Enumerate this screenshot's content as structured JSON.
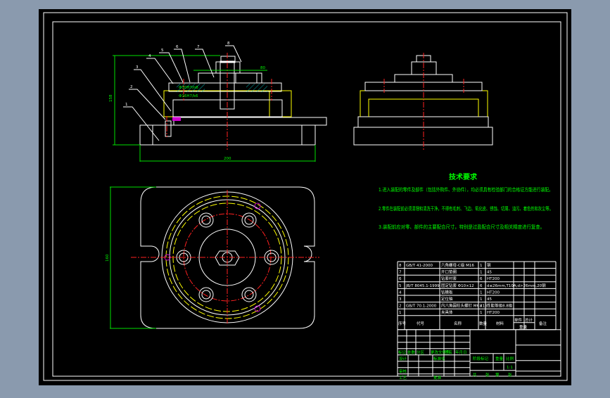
{
  "colors": {
    "background": "#8a9aae",
    "canvas": "#000000",
    "outline": "#ffffff",
    "hidden": "#ffff00",
    "center": "#ff2020",
    "dimension": "#00e000",
    "hatch": "#00d8d8"
  },
  "front_view": {
    "leaders": [
      "1",
      "2",
      "3",
      "4",
      "5",
      "6",
      "7",
      "8"
    ],
    "dims": {
      "height": "158",
      "width": "200",
      "fit1": "Φ10H7/n6",
      "fit2": "Φ16H7/k6",
      "pitch": "80"
    }
  },
  "top_view": {
    "dims": {
      "height": "160"
    }
  },
  "tech_requirements": {
    "title": "技术要求",
    "items": [
      "1.进入装配的零件及部件（包括外购件、外协件），均必须具有检验部门的合格证方能进行装配。",
      "2.零件在装配前必须清理和清洗干净，不得有毛刺、飞边、氧化皮、锈蚀、切屑、油污、着色剂和灰尘等。",
      "3.装配前应对零、部件的主要配合尺寸，特别是过盈配合尺寸及相关精度进行复查。"
    ]
  },
  "parts_list": {
    "rows": [
      {
        "no": "8",
        "code": "GB/T 41-2000",
        "name": "六角螺母-C级 M16",
        "qty": "1",
        "material": "钢"
      },
      {
        "no": "7",
        "code": "",
        "name": "开口垫圈",
        "qty": "1",
        "material": "45"
      },
      {
        "no": "6",
        "code": "",
        "name": "钻套衬套",
        "qty": "6",
        "material": "HT200"
      },
      {
        "no": "5",
        "code": "JB/T 8045.1-1999",
        "name": "固定钻套 Φ10×12",
        "qty": "6",
        "material": "d≤26mm,T10A;d>26mm,20钢"
      },
      {
        "no": "4",
        "code": "",
        "name": "钻模板",
        "qty": "1",
        "material": "HT200"
      },
      {
        "no": "3",
        "code": "",
        "name": "定位轴",
        "qty": "1",
        "material": "45"
      },
      {
        "no": "2",
        "code": "GB/T 70.1-2000",
        "name": "内六角圆柱头螺钉 M6×16",
        "qty": "3",
        "material": "性能等级8.8级"
      },
      {
        "no": "1",
        "code": "",
        "name": "夹具体",
        "qty": "1",
        "material": "HT200"
      }
    ],
    "header": {
      "no": "序号",
      "code": "代号",
      "name": "名称",
      "qty": "数量",
      "material": "材料",
      "single": "单件",
      "total": "总计",
      "weight": "重量",
      "remark": "备注"
    }
  },
  "title_block": {
    "revision_labels": [
      "标记",
      "处数",
      "分区",
      "更改文件号",
      "签名",
      "年月日"
    ],
    "design": "设计",
    "standard": "标准化",
    "review": "审核",
    "process": "工艺",
    "approve": "批准",
    "stage": "阶段标记",
    "weight": "重量",
    "scale_label": "比例",
    "scale": "1:1",
    "sheets": [
      "共",
      "张",
      "第",
      "张"
    ]
  }
}
